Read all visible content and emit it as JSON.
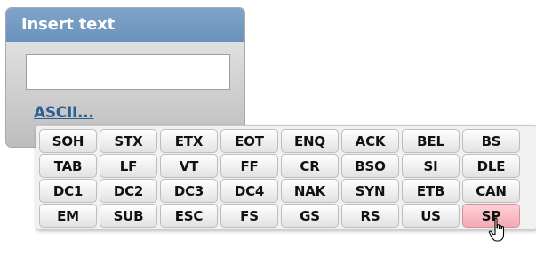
{
  "dialog": {
    "title": "Insert text",
    "input_value": "",
    "ascii_link": "ASCII..."
  },
  "ascii_keys": [
    "SOH",
    "STX",
    "ETX",
    "EOT",
    "ENQ",
    "ACK",
    "BEL",
    "BS",
    "TAB",
    "LF",
    "VT",
    "FF",
    "CR",
    "BSO",
    "SI",
    "DLE",
    "DC1",
    "DC2",
    "DC3",
    "DC4",
    "NAK",
    "SYN",
    "ETB",
    "CAN",
    "EM",
    "SUB",
    "ESC",
    "FS",
    "GS",
    "RS",
    "US",
    "SP"
  ],
  "hovered_key": "SP",
  "colors": {
    "header": "#6a92bb",
    "link": "#2a5f93",
    "hover_key": "#f3aab4"
  }
}
